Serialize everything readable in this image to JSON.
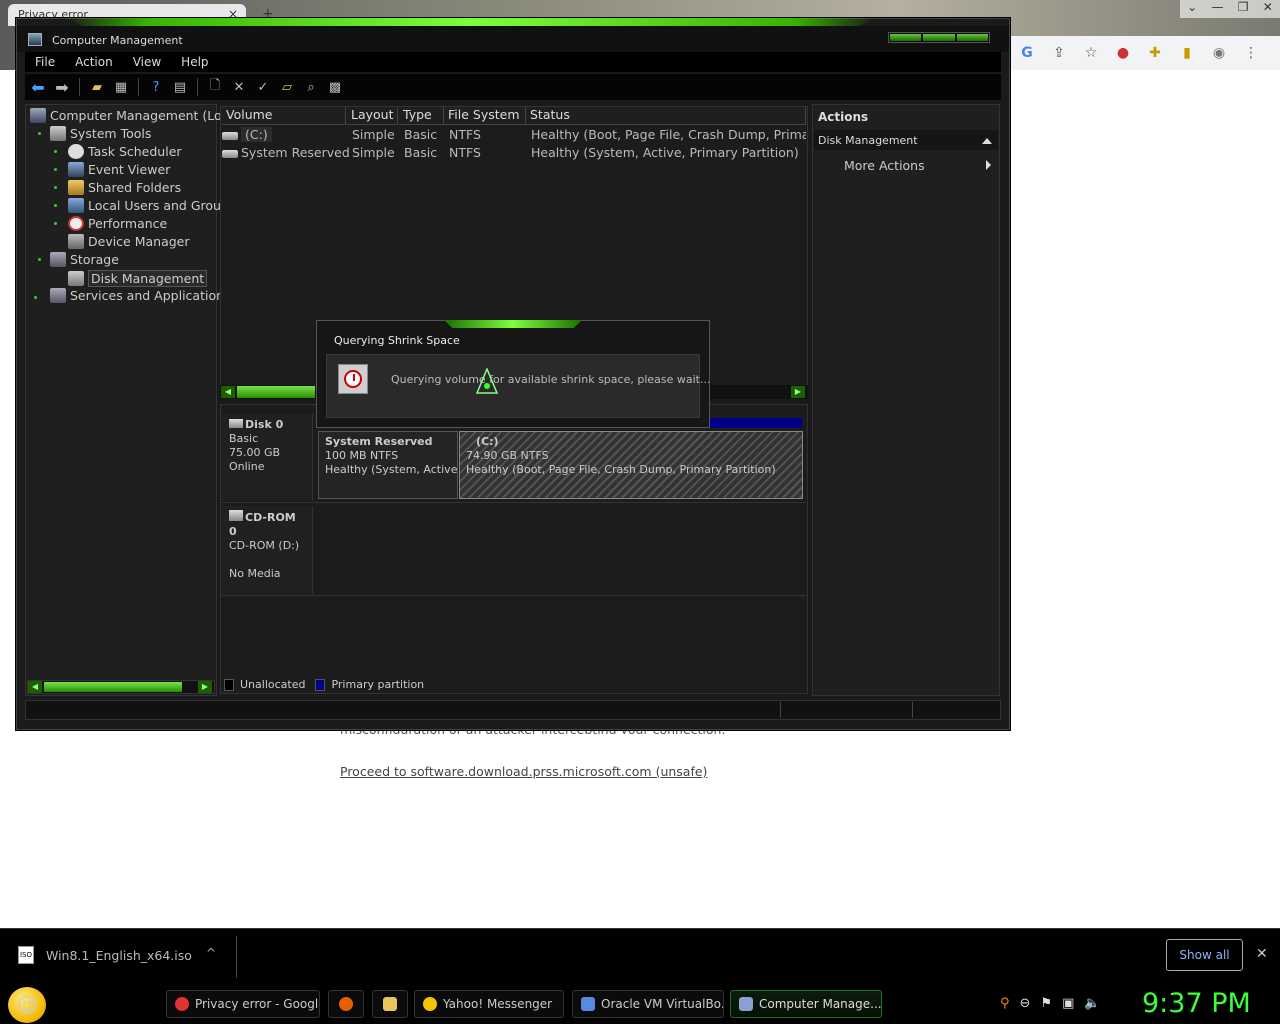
{
  "browser": {
    "tab_title": "Privacy error",
    "tab_close": "×",
    "new_tab": "+",
    "win_buttons": [
      "⌄",
      "—",
      "❐",
      "✕"
    ],
    "partial_text": "misconfiguration or an attacker intercepting your connection.",
    "unsafe_link": "Proceed to software.download.prss.microsoft.com (unsafe)"
  },
  "downloads": {
    "file_name": "Win8.1_English_x64.iso",
    "file_icon": "ISO",
    "chevron": "^",
    "show_all": "Show all",
    "close": "✕"
  },
  "taskbar": {
    "items": [
      {
        "label": "Privacy error - Googl...",
        "icon": "chrome-icon",
        "color": "#d33"
      },
      {
        "label": "",
        "icon": "firefox-icon",
        "color": "#e66000"
      },
      {
        "label": "",
        "icon": "folder-icon",
        "color": "#e8c45a"
      },
      {
        "label": "Yahoo! Messenger",
        "icon": "yahoo-messenger-icon",
        "color": "#f5c400"
      },
      {
        "label": "Oracle VM VirtualBo...",
        "icon": "virtualbox-icon",
        "color": "#5a8ae0"
      },
      {
        "label": "Computer Manage...",
        "icon": "computer-management-icon",
        "color": "#8aa0d0"
      }
    ],
    "clock": "9:37 PM"
  },
  "window": {
    "title": "Computer Management",
    "menu": [
      "File",
      "Action",
      "View",
      "Help"
    ]
  },
  "tree": {
    "root": "Computer Management (Loc",
    "system_tools": "System Tools",
    "task_scheduler": "Task Scheduler",
    "event_viewer": "Event Viewer",
    "shared_folders": "Shared Folders",
    "local_users": "Local Users and Grou",
    "performance": "Performance",
    "device_manager": "Device Manager",
    "storage": "Storage",
    "disk_management": "Disk Management",
    "services": "Services and Application:"
  },
  "volumes": {
    "headers": [
      "Volume",
      "Layout",
      "Type",
      "File System",
      "Status"
    ],
    "rows": [
      {
        "volume": "(C:)",
        "layout": "Simple",
        "type": "Basic",
        "fs": "NTFS",
        "status": "Healthy (Boot, Page File, Crash Dump, Primary"
      },
      {
        "volume": "System Reserved",
        "layout": "Simple",
        "type": "Basic",
        "fs": "NTFS",
        "status": "Healthy (System, Active, Primary Partition)"
      }
    ]
  },
  "disks": {
    "disk0": {
      "name": "Disk 0",
      "type": "Basic",
      "size": "75.00 GB",
      "state": "Online"
    },
    "cdrom0": {
      "name": "CD-ROM 0",
      "drive": "CD-ROM (D:)",
      "media": "No Media"
    },
    "partitions": [
      {
        "name": "System Reserved",
        "size": "100 MB NTFS",
        "status": "Healthy (System, Active, P"
      },
      {
        "name": "(C:)",
        "size": "74.90 GB NTFS",
        "status": "Healthy (Boot, Page File, Crash Dump, Primary Partition)"
      }
    ],
    "legend": [
      {
        "label": "Unallocated",
        "color": "#000000"
      },
      {
        "label": "Primary partition",
        "color": "#00008a"
      }
    ]
  },
  "actions": {
    "header": "Actions",
    "section": "Disk Management",
    "more": "More Actions"
  },
  "dialog": {
    "title": "Querying Shrink Space",
    "message": "Querying volume for available shrink space, please wait..."
  },
  "colors": {
    "accent_green": "#3cff3c",
    "primary_partition": "#00008a"
  }
}
